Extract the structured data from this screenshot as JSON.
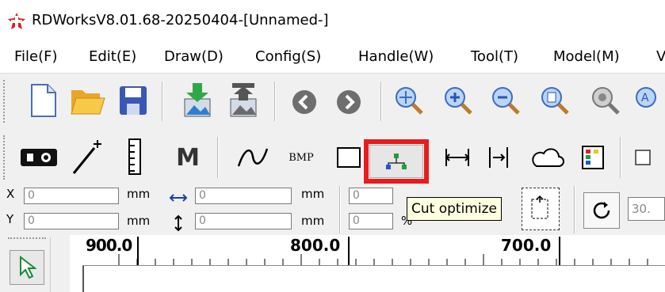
{
  "window": {
    "title": "RDWorksV8.01.68-20250404-[Unnamed-]"
  },
  "menu": {
    "items": [
      "File(F)",
      "Edit(E)",
      "Draw(D)",
      "Config(S)",
      "Handle(W)",
      "Tool(T)",
      "Model(M)",
      "V"
    ]
  },
  "toolbar1": {
    "icons": [
      "new-file-icon",
      "open-folder-icon",
      "save-icon",
      "import-icon",
      "export-icon",
      "back-arrow-icon",
      "forward-arrow-icon",
      "zoom-pan-icon",
      "zoom-in-icon",
      "zoom-out-icon",
      "zoom-page-icon",
      "zoom-select-icon",
      "zoom-all-icon"
    ]
  },
  "toolbar2": {
    "bmp_label": "BMP",
    "m_label": "M",
    "icons": [
      "laser-device-icon",
      "magic-wand-icon",
      "ruler-icon",
      "m-icon",
      "curve-icon",
      "bmp-icon",
      "rectangle-icon",
      "cut-optimize-icon",
      "distance-icon",
      "align-icon",
      "cloud-icon",
      "palette-icon",
      "checkbox-icon"
    ]
  },
  "coords": {
    "x_label": "X",
    "y_label": "Y",
    "x_value": "0",
    "y_value": "0",
    "unit": "mm",
    "w_value": "0",
    "h_value": "0",
    "p1_value": "0",
    "p2_value": "0",
    "pct": "%",
    "rotate_value": "30."
  },
  "tooltip": {
    "text": "Cut optimize"
  },
  "ruler": {
    "labels": [
      "900.0",
      "800.0",
      "700.0"
    ]
  },
  "colors": {
    "highlight": "#e81c1c",
    "tooltip_bg": "#ffffe1"
  }
}
